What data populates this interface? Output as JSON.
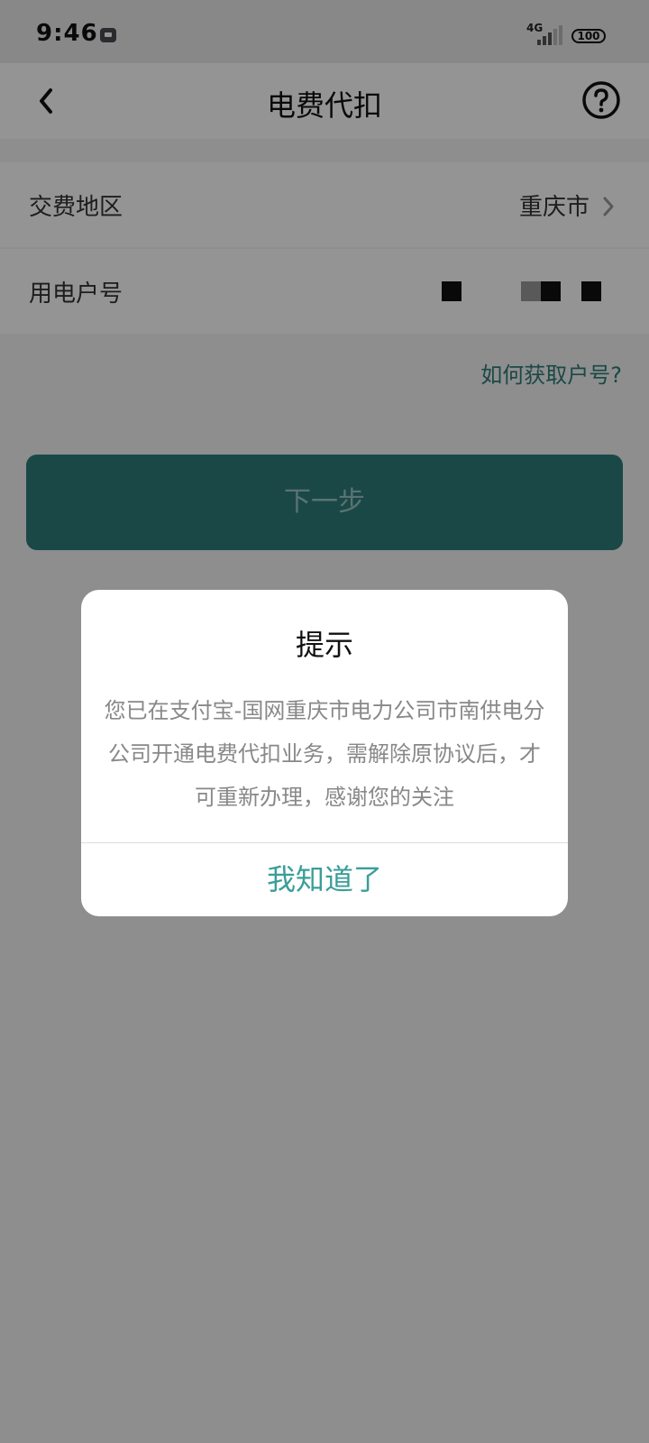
{
  "status_bar": {
    "time": "9:46",
    "network": "4G",
    "battery": "100"
  },
  "nav": {
    "title": "电费代扣"
  },
  "form": {
    "region_label": "交费地区",
    "region_value": "重庆市",
    "account_label": "用电户号"
  },
  "how_to_link": "如何获取户号?",
  "next_button": "下一步",
  "dialog": {
    "title": "提示",
    "message": "您已在支付宝-国网重庆市电力公司市南供电分公司开通电费代扣业务，需解除原协议后，才可重新办理，感谢您的关注",
    "confirm": "我知道了"
  },
  "colors": {
    "accent": "#2e7c7a",
    "dialog_confirm": "#3a9e98"
  },
  "icons": {
    "back": "chevron-left-icon",
    "help": "question-circle-icon",
    "region_arrow": "chevron-right-icon"
  }
}
